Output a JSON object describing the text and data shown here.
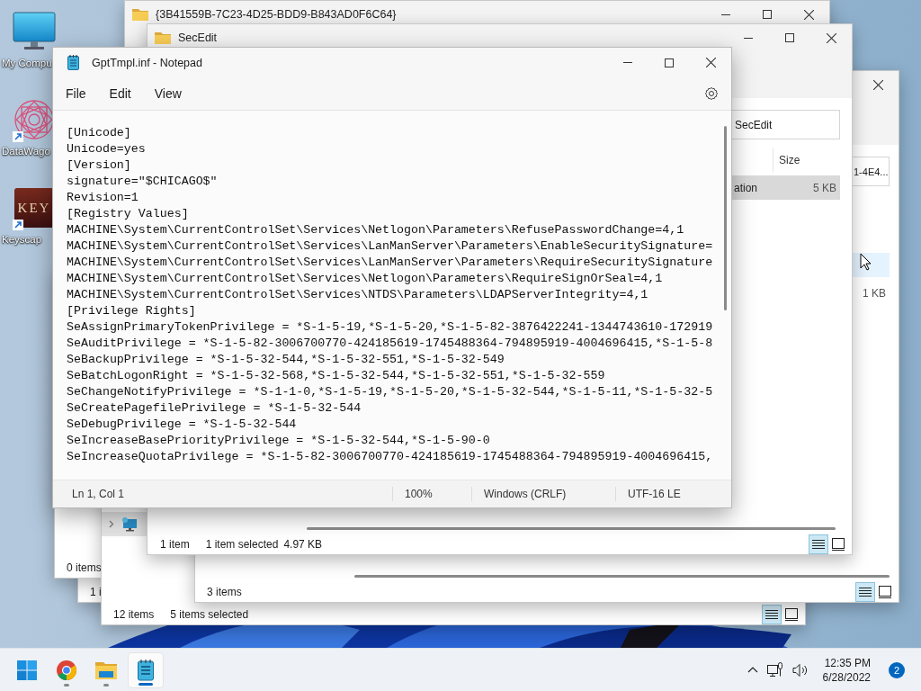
{
  "desktop_icons": [
    {
      "kind": "computer",
      "label": "My Compu",
      "shortcut": false
    },
    {
      "kind": "pattern",
      "label": "DataWago",
      "shortcut": true
    },
    {
      "kind": "key",
      "label": "Keyscap",
      "icon_text": "KEY",
      "shortcut": true
    }
  ],
  "explorer_windows": [
    {
      "item_count": "0 items"
    },
    {
      "item_count": "1 i"
    },
    {
      "title": "{3B41559B-7C23-4D25-BDD9-B843AD0F6C64}"
    },
    {
      "nav_items": [
        {
          "kind": "network"
        }
      ],
      "item_count": "12 items",
      "selection": "5 items selected",
      "views": [
        {
          "kind": "details",
          "selected": true
        },
        {
          "kind": "tiles",
          "selected": false
        }
      ]
    },
    {
      "address": "1-4E4...",
      "rows": [
        {
          "hovered": true
        },
        {
          "size": "1 KB",
          "hovered": false
        }
      ],
      "item_count": "3 items",
      "views": [
        {
          "kind": "details",
          "selected": true
        },
        {
          "kind": "tiles",
          "selected": false
        }
      ]
    },
    {
      "title": "SecEdit",
      "address": "SecEdit",
      "columns": [
        "Size"
      ],
      "rows": [
        {
          "name": "ation",
          "size": "5 KB",
          "selected": true
        }
      ],
      "item_count": "1 item",
      "selection": "1 item selected",
      "selection_size": "4.97 KB",
      "views": [
        {
          "kind": "details",
          "selected": true
        },
        {
          "kind": "tiles",
          "selected": false
        }
      ]
    }
  ],
  "notepad": {
    "title": "GptTmpl.inf - Notepad",
    "menu": [
      "File",
      "Edit",
      "View"
    ],
    "lines": [
      "[Unicode]",
      "Unicode=yes",
      "[Version]",
      "signature=\"$CHICAGO$\"",
      "Revision=1",
      "[Registry Values]",
      "MACHINE\\System\\CurrentControlSet\\Services\\Netlogon\\Parameters\\RefusePasswordChange=4,1",
      "MACHINE\\System\\CurrentControlSet\\Services\\LanManServer\\Parameters\\EnableSecuritySignature=",
      "MACHINE\\System\\CurrentControlSet\\Services\\LanManServer\\Parameters\\RequireSecuritySignature",
      "MACHINE\\System\\CurrentControlSet\\Services\\Netlogon\\Parameters\\RequireSignOrSeal=4,1",
      "MACHINE\\System\\CurrentControlSet\\Services\\NTDS\\Parameters\\LDAPServerIntegrity=4,1",
      "[Privilege Rights]",
      "SeAssignPrimaryTokenPrivilege = *S-1-5-19,*S-1-5-20,*S-1-5-82-3876422241-1344743610-172919",
      "SeAuditPrivilege = *S-1-5-82-3006700770-424185619-1745488364-794895919-4004696415,*S-1-5-8",
      "SeBackupPrivilege = *S-1-5-32-544,*S-1-5-32-551,*S-1-5-32-549",
      "SeBatchLogonRight = *S-1-5-32-568,*S-1-5-32-544,*S-1-5-32-551,*S-1-5-32-559",
      "SeChangeNotifyPrivilege = *S-1-1-0,*S-1-5-19,*S-1-5-20,*S-1-5-32-544,*S-1-5-11,*S-1-5-32-5",
      "SeCreatePagefilePrivilege = *S-1-5-32-544",
      "SeDebugPrivilege = *S-1-5-32-544",
      "SeIncreaseBasePriorityPrivilege = *S-1-5-32-544,*S-1-5-90-0",
      "SeIncreaseQuotaPrivilege = *S-1-5-82-3006700770-424185619-1745488364-794895919-4004696415,"
    ],
    "status": [
      "Ln 1, Col 1",
      "100%",
      "Windows (CRLF)",
      "UTF-16 LE"
    ]
  },
  "taskbar": {
    "apps": [
      {
        "kind": "start",
        "running": false,
        "active": false
      },
      {
        "kind": "browser",
        "running": true,
        "active": false
      },
      {
        "kind": "folder",
        "running": true,
        "active": false
      },
      {
        "kind": "notepad",
        "running": true,
        "active": true
      }
    ],
    "time": "12:35 PM",
    "date": "6/28/2022",
    "notification_count": "2"
  }
}
